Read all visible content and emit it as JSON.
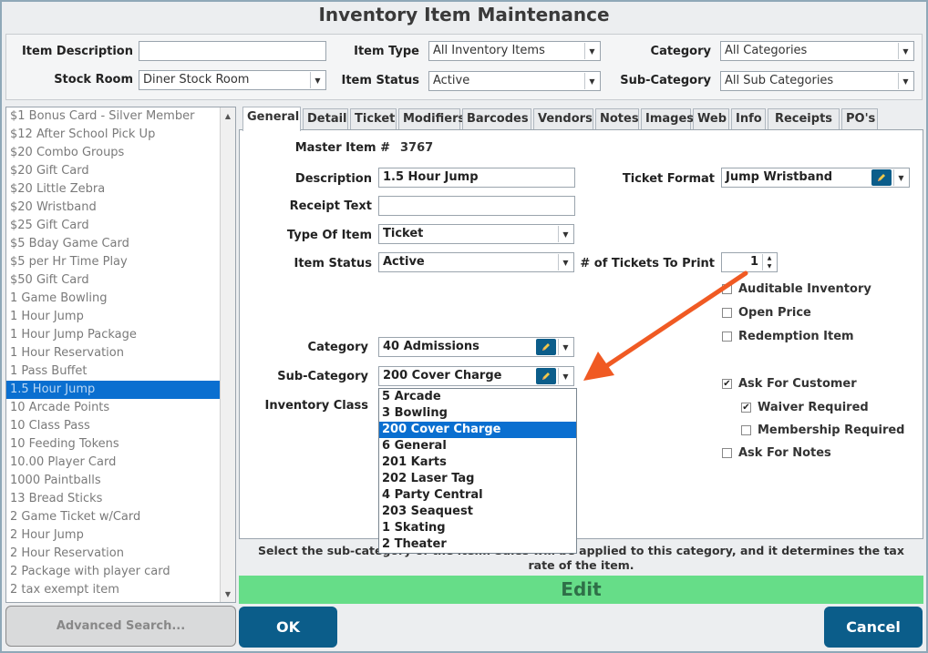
{
  "window": {
    "title": "Inventory Item Maintenance"
  },
  "filters": {
    "item_description_label": "Item Description",
    "item_description_value": "",
    "item_type_label": "Item Type",
    "item_type_value": "All Inventory Items",
    "category_label": "Category",
    "category_value": "All Categories",
    "stock_room_label": "Stock Room",
    "stock_room_value": "Diner Stock Room",
    "item_status_label": "Item Status",
    "item_status_value": "Active",
    "sub_category_label": "Sub-Category",
    "sub_category_value": "All Sub Categories"
  },
  "item_list": {
    "items": [
      "$1 Bonus Card -  Silver Member",
      "$12 After School Pick Up",
      "$20 Combo Groups",
      "$20 Gift Card",
      "$20 Little Zebra",
      "$20 Wristband",
      "$25 Gift Card",
      "$5 Bday Game Card",
      "$5 per Hr Time Play",
      "$50 Gift Card",
      "1 Game Bowling",
      "1 Hour Jump",
      "1 Hour Jump Package",
      "1 Hour Reservation",
      "1 Pass Buffet",
      "1.5 Hour Jump",
      "10 Arcade Points",
      "10 Class Pass",
      "10 Feeding Tokens",
      "10.00 Player Card",
      "1000 Paintballs",
      "13 Bread Sticks",
      "2 Game Ticket w/Card",
      "2 Hour Jump",
      "2 Hour Reservation",
      "2 Package with player card",
      "2 tax exempt item"
    ],
    "selected": "1.5 Hour Jump"
  },
  "tabs": [
    "General",
    "Detail",
    "Ticket",
    "Modifiers",
    "Barcodes",
    "Vendors",
    "Notes",
    "Images",
    "Web",
    "Info",
    "Receipts",
    "PO's"
  ],
  "active_tab": "General",
  "general": {
    "master_item_label": "Master Item #",
    "master_item_value": "3767",
    "description_label": "Description",
    "description_value": "1.5 Hour Jump",
    "receipt_text_label": "Receipt Text",
    "receipt_text_value": "",
    "type_of_item_label": "Type Of Item",
    "type_of_item_value": "Ticket",
    "item_status_label": "Item Status",
    "item_status_value": "Active",
    "ticket_format_label": "Ticket Format",
    "ticket_format_value": "Jump Wristband",
    "tickets_to_print_label": "# of Tickets To Print",
    "tickets_to_print_value": "1",
    "category_label": "Category",
    "category_value": "40 Admissions",
    "sub_category_label": "Sub-Category",
    "sub_category_value": "200 Cover Charge",
    "inventory_class_label": "Inventory Class",
    "checkboxes": {
      "auditable_inventory": {
        "label": "Auditable Inventory",
        "checked": false
      },
      "open_price": {
        "label": "Open Price",
        "checked": false
      },
      "redemption_item": {
        "label": "Redemption Item",
        "checked": false
      },
      "ask_for_customer": {
        "label": "Ask For Customer",
        "checked": true
      },
      "waiver_required": {
        "label": "Waiver Required",
        "checked": true
      },
      "membership_required": {
        "label": "Membership Required",
        "checked": false
      },
      "ask_for_notes": {
        "label": "Ask For Notes",
        "checked": false
      }
    }
  },
  "sub_category_dropdown": {
    "options": [
      "5 Arcade",
      "3 Bowling",
      "200 Cover Charge",
      "6 General",
      "201 Karts",
      "202 Laser Tag",
      "4 Party Central",
      "203 Seaquest",
      "1 Skating",
      "2 Theater"
    ],
    "highlighted": "200 Cover Charge"
  },
  "hint_text": "Select the sub-category of the item. Sales will be applied to this category, and it determines the tax rate of the item.",
  "edit_label": "Edit",
  "buttons": {
    "advanced_search": "Advanced Search...",
    "ok": "OK",
    "cancel": "Cancel"
  },
  "colors": {
    "accent": "#0b5d8a",
    "selection": "#0a6fd0",
    "edit_bar": "#66dd88",
    "arrow": "#f05a23"
  },
  "icons": [
    "chevron-down-icon",
    "chevron-up-icon",
    "edit-pencil-icon",
    "arrow-annotation-icon",
    "check-icon"
  ]
}
